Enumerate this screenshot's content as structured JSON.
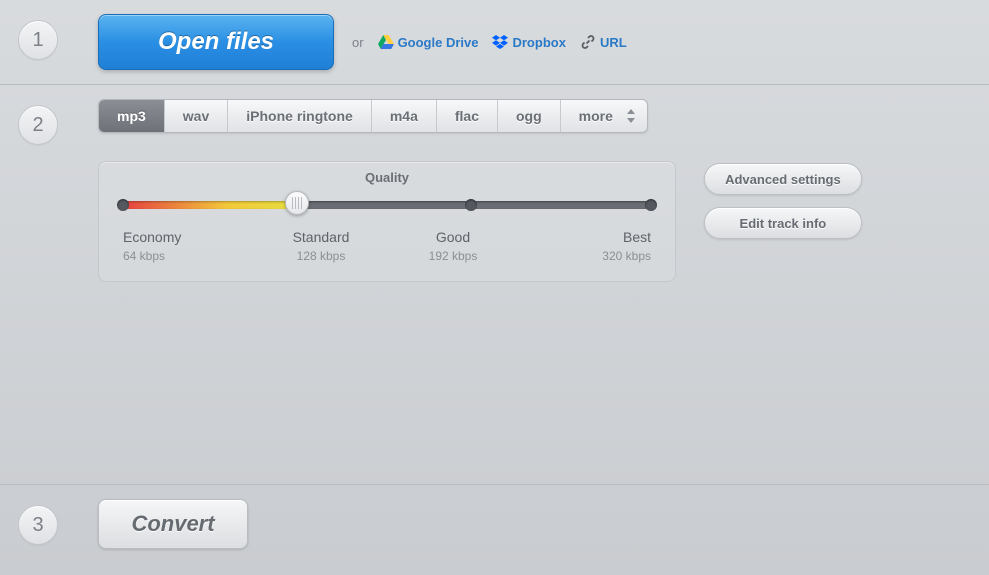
{
  "step1": {
    "number": "1",
    "open_label": "Open files",
    "or_label": "or",
    "sources": {
      "gdrive": "Google Drive",
      "dropbox": "Dropbox",
      "url": "URL"
    }
  },
  "step2": {
    "number": "2",
    "formats": [
      "mp3",
      "wav",
      "iPhone ringtone",
      "m4a",
      "flac",
      "ogg",
      "more"
    ],
    "active_format_index": 0,
    "quality": {
      "title": "Quality",
      "levels": [
        {
          "name": "Economy",
          "rate": "64 kbps"
        },
        {
          "name": "Standard",
          "rate": "128 kbps"
        },
        {
          "name": "Good",
          "rate": "192 kbps"
        },
        {
          "name": "Best",
          "rate": "320 kbps"
        }
      ],
      "selected_index": 1
    },
    "advanced_label": "Advanced settings",
    "edit_track_label": "Edit track info"
  },
  "step3": {
    "number": "3",
    "convert_label": "Convert"
  }
}
